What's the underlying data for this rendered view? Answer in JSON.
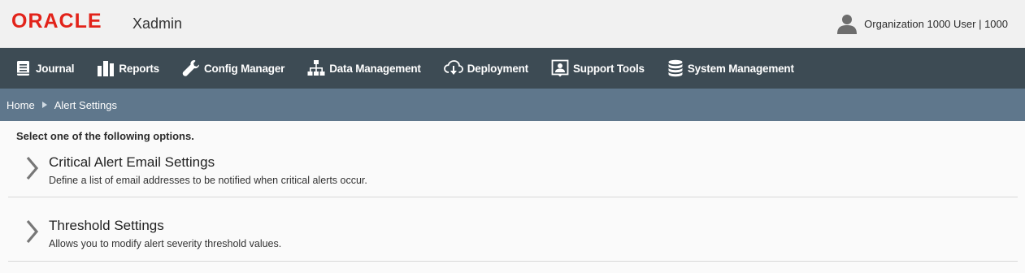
{
  "header": {
    "brand": "ORACLE",
    "app_name": "Xadmin",
    "user_label": "Organization 1000 User | 1000"
  },
  "nav": {
    "items": [
      {
        "label": "Journal",
        "icon": "journal-icon"
      },
      {
        "label": "Reports",
        "icon": "bar-chart-icon"
      },
      {
        "label": "Config Manager",
        "icon": "wrench-icon"
      },
      {
        "label": "Data Management",
        "icon": "hierarchy-icon"
      },
      {
        "label": "Deployment",
        "icon": "cloud-download-icon"
      },
      {
        "label": "Support Tools",
        "icon": "support-person-icon"
      },
      {
        "label": "System Management",
        "icon": "database-icon"
      }
    ]
  },
  "breadcrumb": {
    "home": "Home",
    "current": "Alert Settings"
  },
  "main": {
    "instruction": "Select one of the following options.",
    "options": [
      {
        "title": "Critical Alert Email Settings",
        "description": "Define a list of email addresses to be notified when critical alerts occur."
      },
      {
        "title": "Threshold Settings",
        "description": "Allows you to modify alert severity threshold values."
      }
    ]
  },
  "colors": {
    "brand_red": "#e2231a",
    "navbar": "#3d4b54",
    "breadcrumb_bar": "#5f778c"
  }
}
